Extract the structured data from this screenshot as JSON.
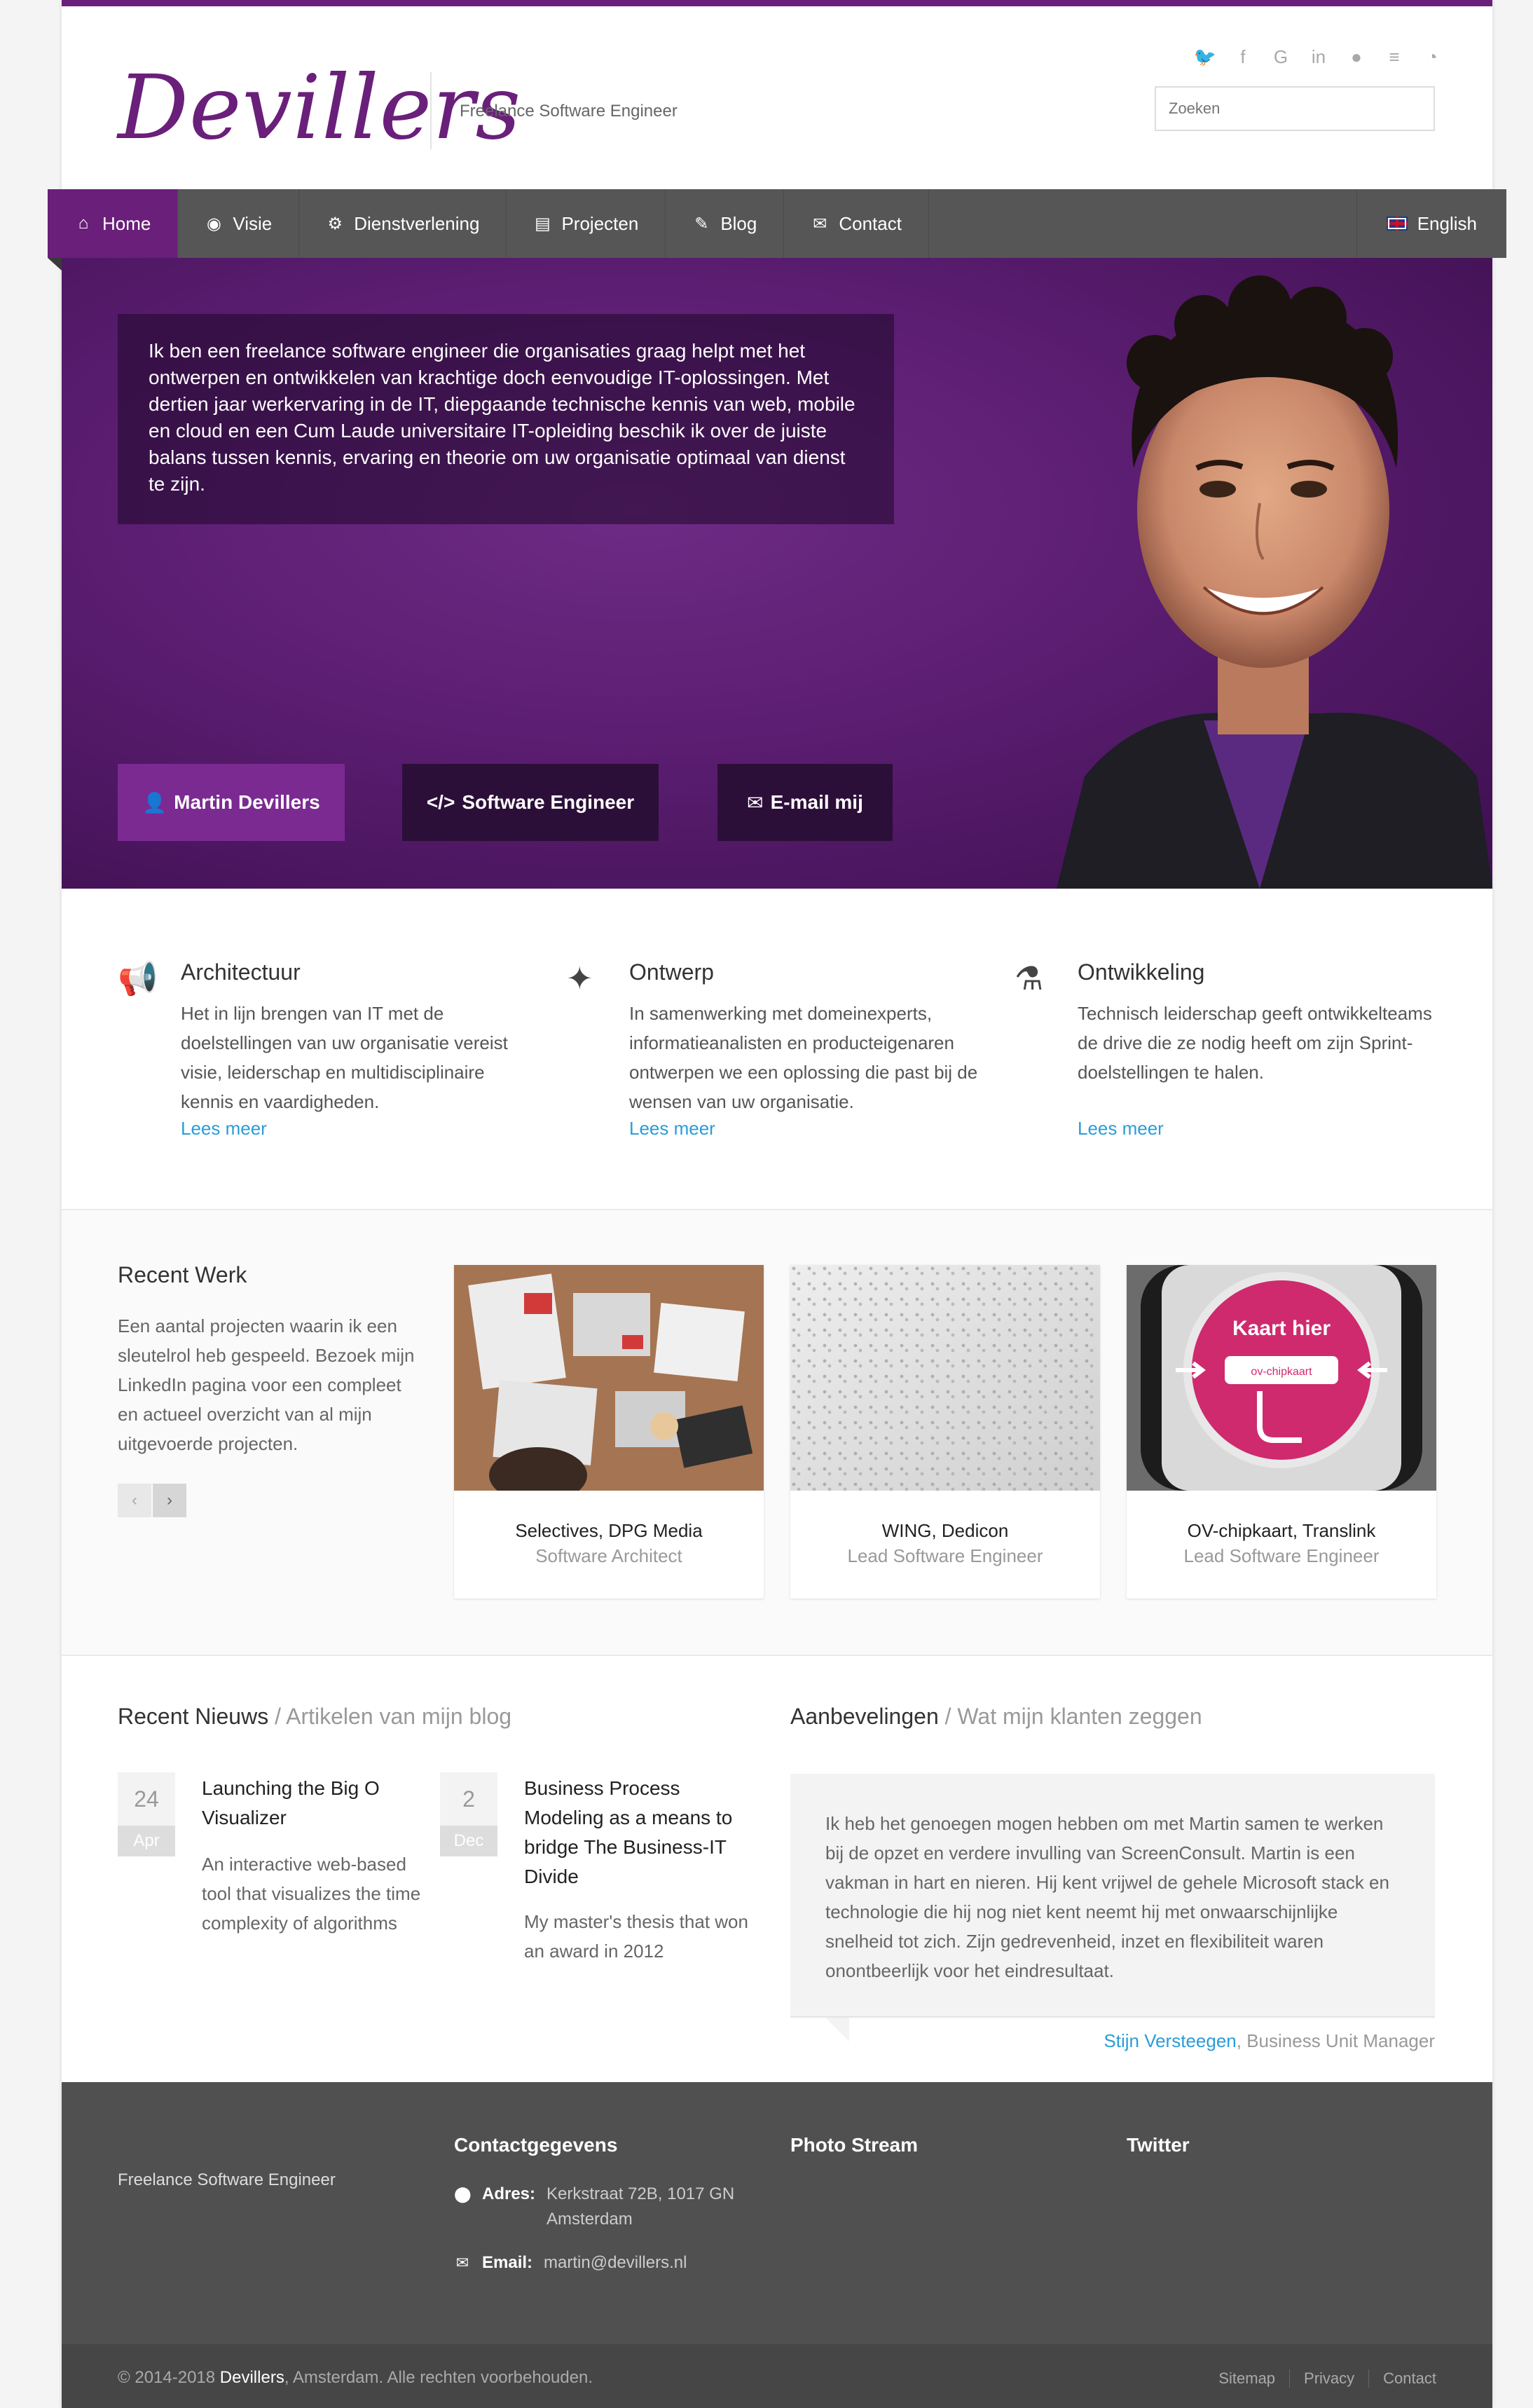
{
  "header": {
    "logo_text": "Devillers",
    "tagline": "Freelance Software Engineer",
    "social_icons": [
      "twitter-icon",
      "facebook-icon",
      "google-plus-icon",
      "linkedin-icon",
      "github-icon",
      "stackoverflow-icon",
      "rss-icon"
    ],
    "search_placeholder": "Zoeken"
  },
  "nav": {
    "items": [
      {
        "label": "Home",
        "icon": "home-icon"
      },
      {
        "label": "Visie",
        "icon": "eye-icon"
      },
      {
        "label": "Dienstverlening",
        "icon": "gear-icon"
      },
      {
        "label": "Projecten",
        "icon": "briefcase-icon"
      },
      {
        "label": "Blog",
        "icon": "pencil-icon"
      },
      {
        "label": "Contact",
        "icon": "envelope-icon"
      }
    ],
    "language": "English"
  },
  "hero": {
    "intro": "Ik ben een freelance software engineer die organisaties graag helpt met het ontwerpen en ontwikkelen van krachtige doch eenvoudige IT-oplossingen. Met dertien jaar werkervaring in de IT, diepgaande technische kennis van web, mobile en cloud en een Cum Laude universitaire IT-opleiding beschik ik over de juiste balans tussen kennis, ervaring en theorie om uw organisatie optimaal van dienst te zijn.",
    "buttons": [
      "Martin Devillers",
      "Software Engineer",
      "E-mail mij"
    ]
  },
  "features": [
    {
      "title": "Architectuur",
      "text": "Het in lijn brengen van IT met de doelstellingen van uw organisatie vereist visie, leiderschap en multidisciplinaire kennis en vaardigheden.",
      "link": "Lees meer"
    },
    {
      "title": "Ontwerp",
      "text": "In samenwerking met domeinexperts, informatieanalisten en producteigenaren ontwerpen we een oplossing die past bij de wensen van uw organisatie.",
      "link": "Lees meer"
    },
    {
      "title": "Ontwikkeling",
      "text": "Technisch leiderschap geeft ontwikkelteams de drive die ze nodig heeft om zijn Sprint-doelstellingen te halen.",
      "link": "Lees meer"
    }
  ],
  "recent_work": {
    "title": "Recent Werk",
    "description": "Een aantal projecten waarin ik een sleutelrol heb gespeeld. Bezoek mijn LinkedIn pagina voor een compleet en actueel overzicht van al mijn uitgevoerde projecten.",
    "projects": [
      {
        "title": "Selectives, DPG Media",
        "role": "Software Architect"
      },
      {
        "title": "WING, Dedicon",
        "role": "Lead Software Engineer"
      },
      {
        "title": "OV-chipkaart, Translink",
        "role": "Lead Software Engineer",
        "sign_text": "Kaart hier",
        "sign_label": "ov-chipkaart"
      }
    ]
  },
  "news": {
    "title": "Recent Nieuws",
    "subtitle": " / Artikelen van mijn blog",
    "items": [
      {
        "day": "24",
        "month": "Apr",
        "title": "Launching the Big O Visualizer",
        "text": "An interactive web-based tool that visualizes the time complexity of algorithms"
      },
      {
        "day": "2",
        "month": "Dec",
        "title": "Business Process Modeling as a means to bridge The Business-IT Divide",
        "text": "My master's thesis that won an award in 2012"
      }
    ]
  },
  "recommendations": {
    "title": "Aanbevelingen",
    "subtitle": " / Wat mijn klanten zeggen",
    "quote": "Ik heb het genoegen mogen hebben om met Martin samen te werken bij de opzet en verdere invulling van ScreenConsult. Martin is een vakman in hart en nieren. Hij kent vrijwel de gehele Microsoft stack en technologie die hij nog niet kent neemt hij met onwaarschijnlijke snelheid tot zich. Zijn gedrevenheid, inzet en flexibiliteit waren onontbeerlijk voor het eindresultaat.",
    "author": "Stijn Versteegen",
    "author_role": ", Business Unit Manager"
  },
  "footer": {
    "tagline": "Freelance Software Engineer",
    "contact_title": "Contactgegevens",
    "address_label": "Adres:",
    "address": "Kerkstraat 72B, 1017 GN Amsterdam",
    "email_label": "Email:",
    "email": "martin@devillers.nl",
    "photo_title": "Photo Stream",
    "twitter_title": "Twitter",
    "copyright_prefix": "© 2014-2018 ",
    "copyright_brand": "Devillers",
    "copyright_suffix": ", Amsterdam. Alle rechten voorbehouden.",
    "links": [
      "Sitemap",
      "Privacy",
      "Contact"
    ]
  },
  "colors": {
    "brand": "#6a1f7a",
    "nav": "#565656",
    "link": "#2b9cd8",
    "footer": "#505050"
  }
}
